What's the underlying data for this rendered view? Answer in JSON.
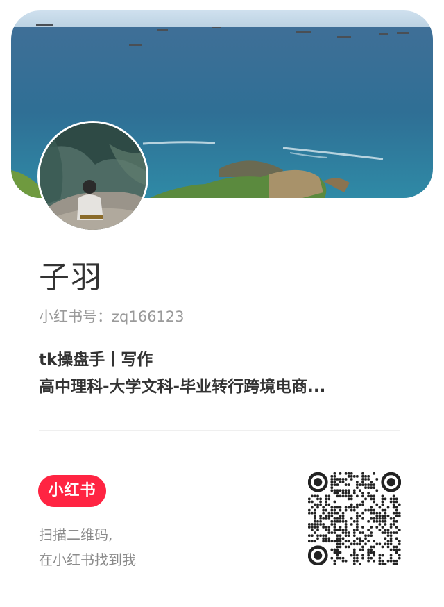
{
  "profile": {
    "name": "子羽",
    "red_id": "小红书号：zq166123",
    "bio_line1": "tk操盘手丨写作",
    "bio_line2": "高中理科-大学文科-毕业转行跨境电商..."
  },
  "footer": {
    "logo_text": "小红书",
    "scan_line1": "扫描二维码,",
    "scan_line2": "在小红书找到我"
  },
  "colors": {
    "brand": "#ff2442",
    "text_primary": "#333333",
    "text_secondary": "#9a9a9a"
  },
  "images": {
    "banner": "ocean-coast-photo",
    "avatar": "person-sitting-on-cliff-photo",
    "qr": "qr-code"
  }
}
